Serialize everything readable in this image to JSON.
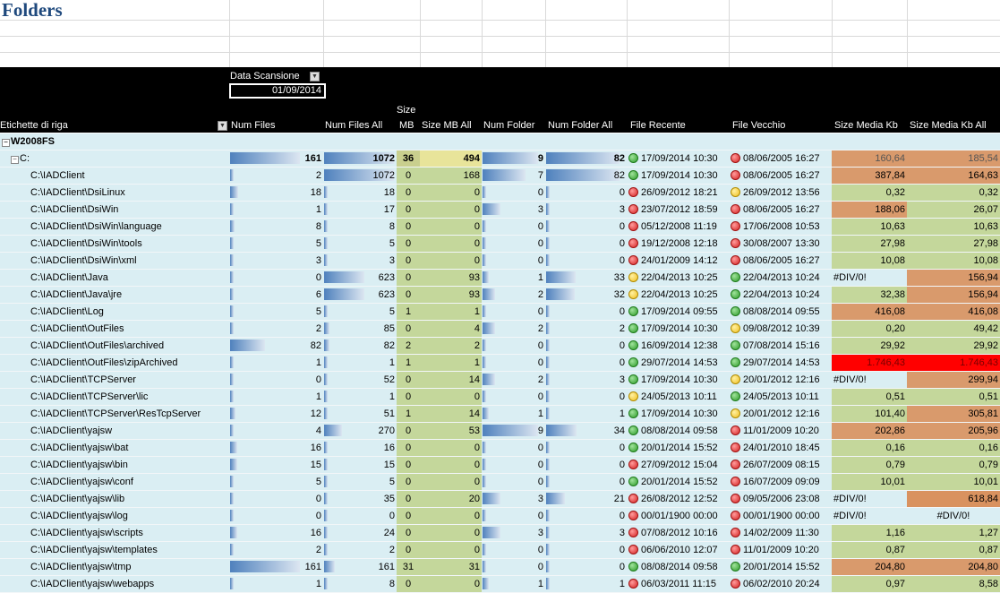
{
  "sheet_title": "Folders",
  "filter": {
    "label": "Data Scansione",
    "value": "01/09/2014"
  },
  "headers": {
    "row_labels": "Etichette di riga",
    "num_files": "Num Files",
    "num_files_all": "Num Files All",
    "size_mb_top": "Size",
    "size_mb_bottom": "MB",
    "size_mb_all": "Size MB All",
    "num_folder": "Num Folder",
    "num_folder_all": "Num Folder All",
    "file_recente": "File Recente",
    "file_vecchio": "File Vecchio",
    "size_media": "Size Media Kb",
    "size_media_all": "Size Media Kb All"
  },
  "colors": {
    "green": "#c4d79b",
    "yellow": "#ebe89a",
    "orange": "#d99a6c",
    "red": "#ff0000",
    "label_bg": "#daeef3"
  },
  "rows": [
    {
      "label": "W2008FS",
      "level": 0,
      "expander": "⊟",
      "bold": true,
      "nf": "",
      "nfa": "",
      "smb": "",
      "smba": "",
      "nfo": "",
      "nfoa": "",
      "rec_dot": "",
      "rec": "",
      "old_dot": "",
      "old": "",
      "sm": "",
      "sma": "",
      "nf_bar": 0,
      "nfa_bar": 0,
      "nfo_bar": 0,
      "nfoa_bar": 0,
      "sm_color": "",
      "sma_color": ""
    },
    {
      "label": "C:",
      "level": 1,
      "expander": "⊟",
      "bold": false,
      "subtotal": true,
      "nf": "161",
      "nfa": "1072",
      "smb": "36",
      "smba": "494",
      "nfo": "9",
      "nfoa": "82",
      "rec_dot": "green",
      "rec": "17/09/2014 10:30",
      "old_dot": "red",
      "old": "08/06/2005 16:27",
      "sm": "160,64",
      "sma": "185,54",
      "nf_bar": 1,
      "nfa_bar": 1,
      "nfo_bar": 1,
      "nfoa_bar": 1,
      "sm_color": "orange",
      "sma_color": "orange"
    },
    {
      "label": "C:\\IADClient",
      "level": 2,
      "nf": "2",
      "nfa": "1072",
      "smb": "0",
      "smba": "168",
      "nfo": "7",
      "nfoa": "82",
      "rec_dot": "green",
      "rec": "17/09/2014 10:30",
      "old_dot": "red",
      "old": "08/06/2005 16:27",
      "sm": "387,84",
      "sma": "164,63",
      "nf_bar": 0.05,
      "nfa_bar": 1,
      "nfo_bar": 0.78,
      "nfoa_bar": 1,
      "sm_color": "orange",
      "sma_color": "orange"
    },
    {
      "label": "C:\\IADClient\\DsiLinux",
      "level": 2,
      "nf": "18",
      "nfa": "18",
      "smb": "0",
      "smba": "0",
      "nfo": "0",
      "nfoa": "0",
      "rec_dot": "red",
      "rec": "26/09/2012 18:21",
      "old_dot": "yellow",
      "old": "26/09/2012 13:56",
      "sm": "0,32",
      "sma": "0,32",
      "nf_bar": 0.12,
      "nfa_bar": 0.04,
      "nfo_bar": 0.04,
      "nfoa_bar": 0.02,
      "sm_color": "green",
      "sma_color": "green"
    },
    {
      "label": "C:\\IADClient\\DsiWin",
      "level": 2,
      "nf": "1",
      "nfa": "17",
      "smb": "0",
      "smba": "0",
      "nfo": "3",
      "nfoa": "3",
      "rec_dot": "red",
      "rec": "23/07/2012 18:59",
      "old_dot": "red",
      "old": "08/06/2005 16:27",
      "sm": "188,06",
      "sma": "26,07",
      "nf_bar": 0.05,
      "nfa_bar": 0.04,
      "nfo_bar": 0.33,
      "nfoa_bar": 0.04,
      "sm_color": "orange",
      "sma_color": "green"
    },
    {
      "label": "C:\\IADClient\\DsiWin\\language",
      "level": 2,
      "nf": "8",
      "nfa": "8",
      "smb": "0",
      "smba": "0",
      "nfo": "0",
      "nfoa": "0",
      "rec_dot": "red",
      "rec": "05/12/2008 11:19",
      "old_dot": "red",
      "old": "17/06/2008 10:53",
      "sm": "10,63",
      "sma": "10,63",
      "nf_bar": 0.06,
      "nfa_bar": 0.02,
      "nfo_bar": 0.04,
      "nfoa_bar": 0.02,
      "sm_color": "green",
      "sma_color": "green"
    },
    {
      "label": "C:\\IADClient\\DsiWin\\tools",
      "level": 2,
      "nf": "5",
      "nfa": "5",
      "smb": "0",
      "smba": "0",
      "nfo": "0",
      "nfoa": "0",
      "rec_dot": "red",
      "rec": "19/12/2008 12:18",
      "old_dot": "red",
      "old": "30/08/2007 13:30",
      "sm": "27,98",
      "sma": "27,98",
      "nf_bar": 0.05,
      "nfa_bar": 0.02,
      "nfo_bar": 0.04,
      "nfoa_bar": 0.02,
      "sm_color": "green",
      "sma_color": "green"
    },
    {
      "label": "C:\\IADClient\\DsiWin\\xml",
      "level": 2,
      "nf": "3",
      "nfa": "3",
      "smb": "0",
      "smba": "0",
      "nfo": "0",
      "nfoa": "0",
      "rec_dot": "red",
      "rec": "24/01/2009 14:12",
      "old_dot": "red",
      "old": "08/06/2005 16:27",
      "sm": "10,08",
      "sma": "10,08",
      "nf_bar": 0.05,
      "nfa_bar": 0.02,
      "nfo_bar": 0.04,
      "nfoa_bar": 0.02,
      "sm_color": "green",
      "sma_color": "green"
    },
    {
      "label": "C:\\IADClient\\Java",
      "level": 2,
      "nf": "0",
      "nfa": "623",
      "smb": "0",
      "smba": "93",
      "nfo": "1",
      "nfoa": "33",
      "rec_dot": "yellow",
      "rec": "22/04/2013 10:25",
      "old_dot": "green",
      "old": "22/04/2013 10:24",
      "sm": "#DIV/0!",
      "sma": "156,94",
      "nf_bar": 0,
      "nfa_bar": 0.58,
      "nfo_bar": 0.11,
      "nfoa_bar": 0.4,
      "sm_color": "none",
      "sma_color": "orange"
    },
    {
      "label": "C:\\IADClient\\Java\\jre",
      "level": 2,
      "nf": "6",
      "nfa": "623",
      "smb": "0",
      "smba": "93",
      "nfo": "2",
      "nfoa": "32",
      "rec_dot": "yellow",
      "rec": "22/04/2013 10:25",
      "old_dot": "green",
      "old": "22/04/2013 10:24",
      "sm": "32,38",
      "sma": "156,94",
      "nf_bar": 0.05,
      "nfa_bar": 0.58,
      "nfo_bar": 0.22,
      "nfoa_bar": 0.39,
      "sm_color": "green",
      "sma_color": "orange"
    },
    {
      "label": "C:\\IADClient\\Log",
      "level": 2,
      "nf": "5",
      "nfa": "5",
      "smb": "1",
      "smba": "1",
      "nfo": "0",
      "nfoa": "0",
      "rec_dot": "green",
      "rec": "17/09/2014 09:55",
      "old_dot": "green",
      "old": "08/08/2014 09:55",
      "sm": "416,08",
      "sma": "416,08",
      "nf_bar": 0.05,
      "nfa_bar": 0.02,
      "nfo_bar": 0.04,
      "nfoa_bar": 0.02,
      "sm_color": "orange",
      "sma_color": "orange"
    },
    {
      "label": "C:\\IADClient\\OutFiles",
      "level": 2,
      "nf": "2",
      "nfa": "85",
      "smb": "0",
      "smba": "4",
      "nfo": "2",
      "nfoa": "2",
      "rec_dot": "green",
      "rec": "17/09/2014 10:30",
      "old_dot": "yellow",
      "old": "09/08/2012 10:39",
      "sm": "0,20",
      "sma": "49,42",
      "nf_bar": 0.05,
      "nfa_bar": 0.08,
      "nfo_bar": 0.22,
      "nfoa_bar": 0.03,
      "sm_color": "green",
      "sma_color": "green"
    },
    {
      "label": "C:\\IADClient\\OutFiles\\archived",
      "level": 2,
      "nf": "82",
      "nfa": "82",
      "smb": "2",
      "smba": "2",
      "nfo": "0",
      "nfoa": "0",
      "rec_dot": "green",
      "rec": "16/09/2014 12:38",
      "old_dot": "green",
      "old": "07/08/2014 15:16",
      "sm": "29,92",
      "sma": "29,92",
      "nf_bar": 0.5,
      "nfa_bar": 0.08,
      "nfo_bar": 0.04,
      "nfoa_bar": 0.02,
      "sm_color": "green",
      "sma_color": "green"
    },
    {
      "label": "C:\\IADClient\\OutFiles\\zipArchived",
      "level": 2,
      "nf": "1",
      "nfa": "1",
      "smb": "1",
      "smba": "1",
      "nfo": "0",
      "nfoa": "0",
      "rec_dot": "green",
      "rec": "29/07/2014 14:53",
      "old_dot": "green",
      "old": "29/07/2014 14:53",
      "sm": "1.746,43",
      "sma": "1.746,43",
      "nf_bar": 0.05,
      "nfa_bar": 0.02,
      "nfo_bar": 0.04,
      "nfoa_bar": 0.02,
      "sm_color": "red",
      "sma_color": "red"
    },
    {
      "label": "C:\\IADClient\\TCPServer",
      "level": 2,
      "nf": "0",
      "nfa": "52",
      "smb": "0",
      "smba": "14",
      "nfo": "2",
      "nfoa": "3",
      "rec_dot": "green",
      "rec": "17/09/2014 10:30",
      "old_dot": "yellow",
      "old": "20/01/2012 12:16",
      "sm": "#DIV/0!",
      "sma": "299,94",
      "nf_bar": 0,
      "nfa_bar": 0.05,
      "nfo_bar": 0.22,
      "nfoa_bar": 0.04,
      "sm_color": "none",
      "sma_color": "orange"
    },
    {
      "label": "C:\\IADClient\\TCPServer\\lic",
      "level": 2,
      "nf": "1",
      "nfa": "1",
      "smb": "0",
      "smba": "0",
      "nfo": "0",
      "nfoa": "0",
      "rec_dot": "yellow",
      "rec": "24/05/2013 10:11",
      "old_dot": "green",
      "old": "24/05/2013 10:11",
      "sm": "0,51",
      "sma": "0,51",
      "nf_bar": 0.05,
      "nfa_bar": 0.02,
      "nfo_bar": 0.04,
      "nfoa_bar": 0.02,
      "sm_color": "green",
      "sma_color": "green"
    },
    {
      "label": "C:\\IADClient\\TCPServer\\ResTcpServer",
      "level": 2,
      "nf": "12",
      "nfa": "51",
      "smb": "1",
      "smba": "14",
      "nfo": "1",
      "nfoa": "1",
      "rec_dot": "green",
      "rec": "17/09/2014 10:30",
      "old_dot": "yellow",
      "old": "20/01/2012 12:16",
      "sm": "101,40",
      "sma": "305,81",
      "nf_bar": 0.08,
      "nfa_bar": 0.05,
      "nfo_bar": 0.11,
      "nfoa_bar": 0.02,
      "sm_color": "green",
      "sma_color": "orange"
    },
    {
      "label": "C:\\IADClient\\yajsw",
      "level": 2,
      "nf": "4",
      "nfa": "270",
      "smb": "0",
      "smba": "53",
      "nfo": "9",
      "nfoa": "34",
      "rec_dot": "green",
      "rec": "08/08/2014 09:58",
      "old_dot": "red",
      "old": "11/01/2009 10:20",
      "sm": "202,86",
      "sma": "205,96",
      "nf_bar": 0.05,
      "nfa_bar": 0.25,
      "nfo_bar": 1,
      "nfoa_bar": 0.41,
      "sm_color": "orange",
      "sma_color": "orange"
    },
    {
      "label": "C:\\IADClient\\yajsw\\bat",
      "level": 2,
      "nf": "16",
      "nfa": "16",
      "smb": "0",
      "smba": "0",
      "nfo": "0",
      "nfoa": "0",
      "rec_dot": "green",
      "rec": "20/01/2014 15:52",
      "old_dot": "red",
      "old": "24/01/2010 18:45",
      "sm": "0,16",
      "sma": "0,16",
      "nf_bar": 0.1,
      "nfa_bar": 0.03,
      "nfo_bar": 0.04,
      "nfoa_bar": 0.02,
      "sm_color": "green",
      "sma_color": "green"
    },
    {
      "label": "C:\\IADClient\\yajsw\\bin",
      "level": 2,
      "nf": "15",
      "nfa": "15",
      "smb": "0",
      "smba": "0",
      "nfo": "0",
      "nfoa": "0",
      "rec_dot": "red",
      "rec": "27/09/2012 15:04",
      "old_dot": "red",
      "old": "26/07/2009 08:15",
      "sm": "0,79",
      "sma": "0,79",
      "nf_bar": 0.1,
      "nfa_bar": 0.03,
      "nfo_bar": 0.04,
      "nfoa_bar": 0.02,
      "sm_color": "green",
      "sma_color": "green"
    },
    {
      "label": "C:\\IADClient\\yajsw\\conf",
      "level": 2,
      "nf": "5",
      "nfa": "5",
      "smb": "0",
      "smba": "0",
      "nfo": "0",
      "nfoa": "0",
      "rec_dot": "green",
      "rec": "20/01/2014 15:52",
      "old_dot": "red",
      "old": "16/07/2009 09:09",
      "sm": "10,01",
      "sma": "10,01",
      "nf_bar": 0.05,
      "nfa_bar": 0.02,
      "nfo_bar": 0.04,
      "nfoa_bar": 0.02,
      "sm_color": "green",
      "sma_color": "green"
    },
    {
      "label": "C:\\IADClient\\yajsw\\lib",
      "level": 2,
      "nf": "0",
      "nfa": "35",
      "smb": "0",
      "smba": "20",
      "nfo": "3",
      "nfoa": "21",
      "rec_dot": "red",
      "rec": "26/08/2012 12:52",
      "old_dot": "red",
      "old": "09/05/2006 23:08",
      "sm": "#DIV/0!",
      "sma": "618,84",
      "nf_bar": 0,
      "nfa_bar": 0.04,
      "nfo_bar": 0.33,
      "nfoa_bar": 0.26,
      "sm_color": "none",
      "sma_color": "darkorange"
    },
    {
      "label": "C:\\IADClient\\yajsw\\log",
      "level": 2,
      "nf": "0",
      "nfa": "0",
      "smb": "0",
      "smba": "0",
      "nfo": "0",
      "nfoa": "0",
      "rec_dot": "red",
      "rec": "00/01/1900 00:00",
      "old_dot": "red",
      "old": "00/01/1900 00:00",
      "sm": "#DIV/0!",
      "sma": "#DIV/0!",
      "nf_bar": 0,
      "nfa_bar": 0,
      "nfo_bar": 0.04,
      "nfoa_bar": 0.02,
      "sm_color": "none",
      "sma_color": "none",
      "center_div": true
    },
    {
      "label": "C:\\IADClient\\yajsw\\scripts",
      "level": 2,
      "nf": "16",
      "nfa": "24",
      "smb": "0",
      "smba": "0",
      "nfo": "3",
      "nfoa": "3",
      "rec_dot": "red",
      "rec": "07/08/2012 10:16",
      "old_dot": "red",
      "old": "14/02/2009 11:30",
      "sm": "1,16",
      "sma": "1,27",
      "nf_bar": 0.1,
      "nfa_bar": 0.03,
      "nfo_bar": 0.33,
      "nfoa_bar": 0.04,
      "sm_color": "green",
      "sma_color": "green"
    },
    {
      "label": "C:\\IADClient\\yajsw\\templates",
      "level": 2,
      "nf": "2",
      "nfa": "2",
      "smb": "0",
      "smba": "0",
      "nfo": "0",
      "nfoa": "0",
      "rec_dot": "red",
      "rec": "06/06/2010 12:07",
      "old_dot": "red",
      "old": "11/01/2009 10:20",
      "sm": "0,87",
      "sma": "0,87",
      "nf_bar": 0.05,
      "nfa_bar": 0.02,
      "nfo_bar": 0.04,
      "nfoa_bar": 0.02,
      "sm_color": "green",
      "sma_color": "green"
    },
    {
      "label": "C:\\IADClient\\yajsw\\tmp",
      "level": 2,
      "nf": "161",
      "nfa": "161",
      "smb": "31",
      "smba": "31",
      "nfo": "0",
      "nfoa": "0",
      "rec_dot": "green",
      "rec": "08/08/2014 09:58",
      "old_dot": "green",
      "old": "20/01/2014 15:52",
      "sm": "204,80",
      "sma": "204,80",
      "nf_bar": 1,
      "nfa_bar": 0.15,
      "nfo_bar": 0.04,
      "nfoa_bar": 0.02,
      "sm_color": "orange",
      "sma_color": "orange"
    },
    {
      "label": "C:\\IADClient\\yajsw\\webapps",
      "level": 2,
      "nf": "1",
      "nfa": "8",
      "smb": "0",
      "smba": "0",
      "nfo": "1",
      "nfoa": "1",
      "rec_dot": "red",
      "rec": "06/03/2011 11:15",
      "old_dot": "red",
      "old": "06/02/2010 20:24",
      "sm": "0,97",
      "sma": "8,58",
      "nf_bar": 0.05,
      "nfa_bar": 0.02,
      "nfo_bar": 0.11,
      "nfoa_bar": 0.02,
      "sm_color": "green",
      "sma_color": "green"
    }
  ]
}
